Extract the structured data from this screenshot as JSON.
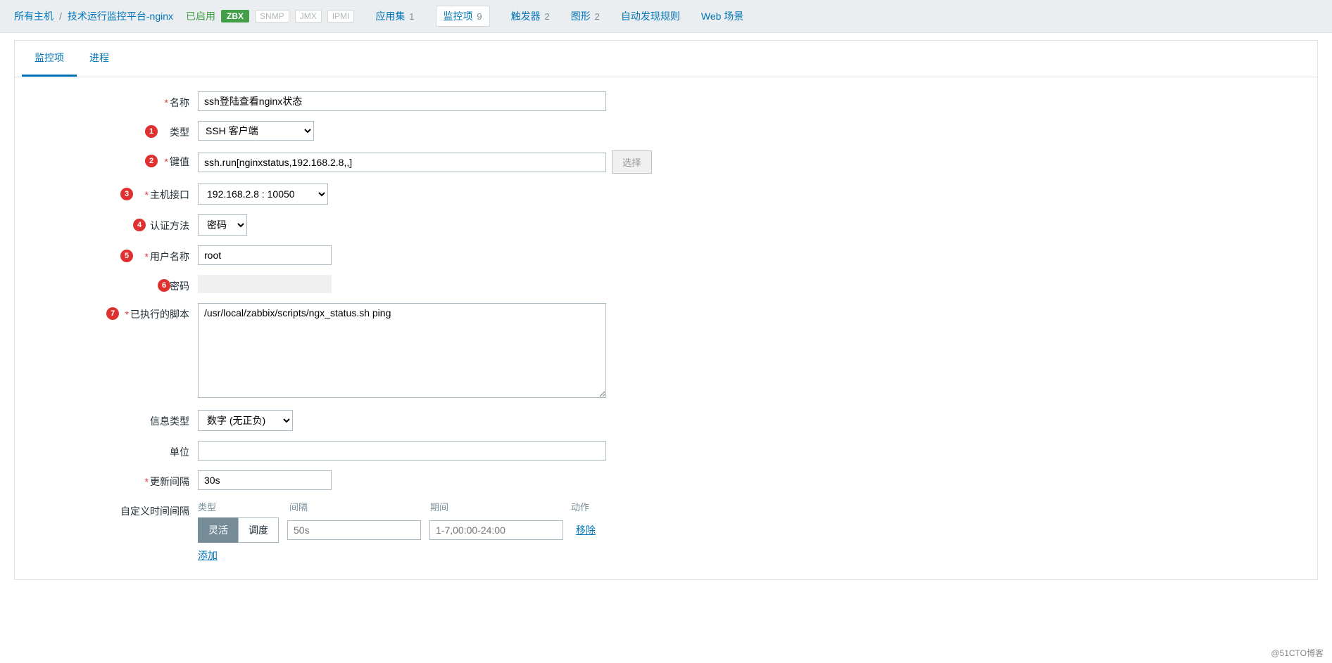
{
  "breadcrumb": {
    "all_hosts": "所有主机",
    "sep": "/",
    "host": "技术运行监控平台-nginx"
  },
  "status": {
    "enabled": "已启用",
    "zbx": "ZBX",
    "snmp": "SNMP",
    "jmx": "JMX",
    "ipmi": "IPMI"
  },
  "topnav": {
    "apps": {
      "label": "应用集",
      "count": "1"
    },
    "items": {
      "label": "监控项",
      "count": "9"
    },
    "triggers": {
      "label": "触发器",
      "count": "2"
    },
    "graphs": {
      "label": "图形",
      "count": "2"
    },
    "discovery": {
      "label": "自动发现规则"
    },
    "web": {
      "label": "Web 场景"
    }
  },
  "tabs": {
    "item": "监控项",
    "process": "进程"
  },
  "labels": {
    "name": "名称",
    "type": "类型",
    "key": "键值",
    "host_interface": "主机接口",
    "auth_method": "认证方法",
    "username": "用户名称",
    "password": "密码",
    "executed_script": "已执行的脚本",
    "info_type": "信息类型",
    "units": "单位",
    "update_interval": "更新间隔",
    "custom_intervals": "自定义时间间隔"
  },
  "values": {
    "name": "ssh登陆查看nginx状态",
    "type": "SSH 客户端",
    "key": "ssh.run[nginxstatus,192.168.2.8,,]",
    "host_interface": "192.168.2.8 : 10050",
    "auth_method": "密码",
    "username": "root",
    "password": "",
    "executed_script": "/usr/local/zabbix/scripts/ngx_status.sh ping",
    "info_type": "数字 (无正负)",
    "units": "",
    "update_interval": "30s"
  },
  "buttons": {
    "select": "选择"
  },
  "intervals": {
    "header": {
      "type": "类型",
      "interval": "间隔",
      "period": "期间",
      "action": "动作"
    },
    "toggle": {
      "flexible": "灵活",
      "scheduling": "调度"
    },
    "row": {
      "interval_ph": "50s",
      "period_ph": "1-7,00:00-24:00",
      "remove": "移除"
    },
    "add": "添加"
  },
  "bullets": {
    "b1": "1",
    "b2": "2",
    "b3": "3",
    "b4": "4",
    "b5": "5",
    "b6": "6",
    "b7": "7"
  },
  "footer": "@51CTO博客"
}
